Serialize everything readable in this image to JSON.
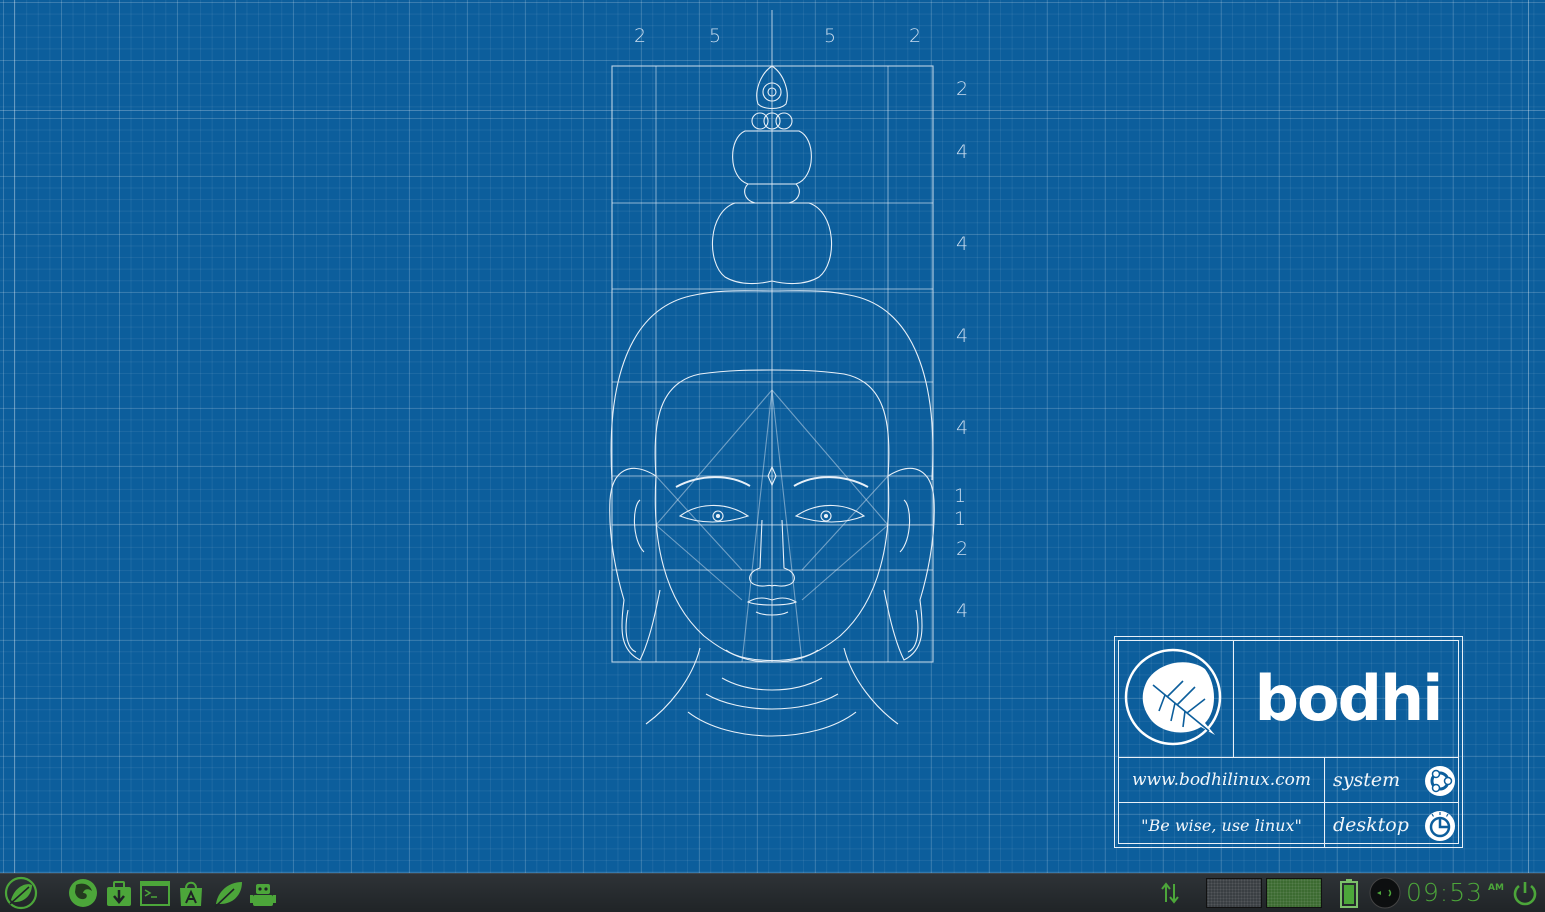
{
  "wallpaper": {
    "dimension_labels_top": [
      "2",
      "5",
      "5",
      "2"
    ],
    "dimension_labels_side": [
      "2",
      "4",
      "4",
      "4",
      "4",
      "1",
      "1",
      "2",
      "4"
    ]
  },
  "logo": {
    "word": "bodhi",
    "url": "www.bodhilinux.com",
    "slogan": "\"Be wise, use linux\"",
    "system_label": "system",
    "desktop_label": "desktop"
  },
  "taskbar": {
    "launchers": [
      "start-menu-icon",
      "firefox-icon",
      "package-install-icon",
      "terminal-icon",
      "app-store-icon",
      "leaf-icon",
      "robot-icon"
    ],
    "clock": "09:53",
    "ampm": "AM",
    "accent": "#4ca63a"
  },
  "colors": {
    "blueprint": "#0c5e9c",
    "line": "#e8f0f8",
    "taskbar": "#2a2f33"
  }
}
